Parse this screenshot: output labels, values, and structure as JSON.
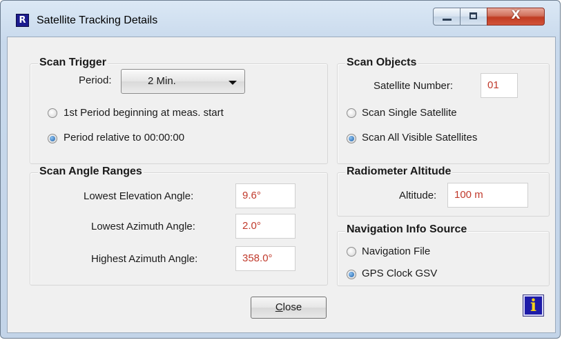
{
  "window": {
    "title": "Satellite Tracking Details",
    "app_icon_glyph": "R",
    "close_glyph": "X"
  },
  "scan_trigger": {
    "title": "Scan Trigger",
    "period_label": "Period:",
    "period_value": "2 Min.",
    "options": [
      {
        "label": "1st Period beginning at meas. start",
        "selected": false
      },
      {
        "label": "Period relative to 00:00:00",
        "selected": true
      }
    ]
  },
  "scan_angle_ranges": {
    "title": "Scan Angle Ranges",
    "lowest_elevation_label": "Lowest Elevation Angle:",
    "lowest_elevation_value": "9.6°",
    "lowest_azimuth_label": "Lowest Azimuth Angle:",
    "lowest_azimuth_value": "2.0°",
    "highest_azimuth_label": "Highest Azimuth Angle:",
    "highest_azimuth_value": "358.0°"
  },
  "scan_objects": {
    "title": "Scan Objects",
    "satellite_number_label": "Satellite Number:",
    "satellite_number_value": "01",
    "options": [
      {
        "label": "Scan Single Satellite",
        "selected": false
      },
      {
        "label": "Scan All Visible Satellites",
        "selected": true
      }
    ]
  },
  "radiometer_altitude": {
    "title": "Radiometer Altitude",
    "altitude_label": "Altitude:",
    "altitude_value": "100 m"
  },
  "navigation_info_source": {
    "title": "Navigation Info Source",
    "options": [
      {
        "label": "Navigation File",
        "selected": false
      },
      {
        "label": "GPS Clock GSV",
        "selected": true
      }
    ]
  },
  "buttons": {
    "close_mnemonic": "C",
    "close_rest": "lose",
    "info_glyph": "i"
  },
  "colors": {
    "value_text": "#c0392b",
    "info_button": "#1d1ba8",
    "window_close": "#c03c22"
  }
}
